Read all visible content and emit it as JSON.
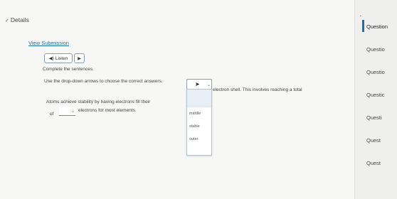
{
  "header": {
    "details_label": "Details"
  },
  "submission": {
    "view_label": "View Submission"
  },
  "audio": {
    "listen_label": "Listen"
  },
  "question": {
    "instruction1": "Complete the sentences.",
    "instruction2": "Use the drop-down arrows to choose the correct answers.",
    "sentence_part1": "Atoms achieve stability by having electrons fill their",
    "sentence_part2": "electron shell. This involves reaching a total",
    "sentence_part3_prefix": "of",
    "sentence_part3_suffix": "electrons for most elements."
  },
  "dropdown": {
    "options": [
      "middle",
      "stable",
      "outer"
    ]
  },
  "sidebar": {
    "items": [
      {
        "label": "Question"
      },
      {
        "label": "Questio"
      },
      {
        "label": "Questio"
      },
      {
        "label": "Questic"
      },
      {
        "label": "Questi"
      },
      {
        "label": "Quest"
      },
      {
        "label": "Quest"
      }
    ]
  }
}
